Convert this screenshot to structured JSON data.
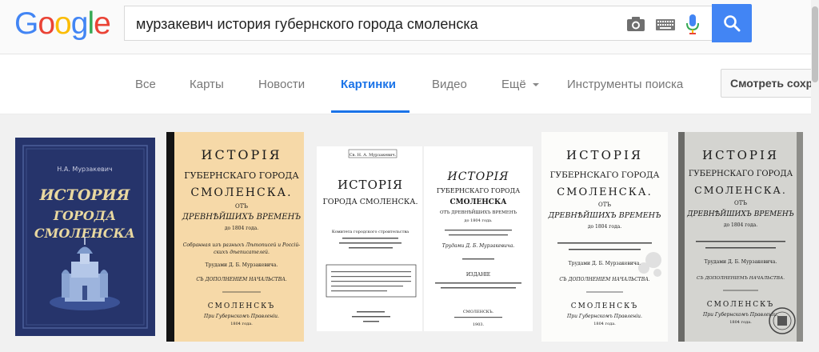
{
  "logo": {
    "text": "Google",
    "letters": [
      "G",
      "o",
      "o",
      "g",
      "l",
      "e"
    ],
    "colors": [
      "#4285f4",
      "#ea4335",
      "#fbbc05",
      "#4285f4",
      "#34a853",
      "#ea4335"
    ]
  },
  "search": {
    "query": "мурзакевич история губернского города смоленска"
  },
  "tabs": [
    {
      "label": "Все"
    },
    {
      "label": "Карты"
    },
    {
      "label": "Новости"
    },
    {
      "label": "Картинки",
      "active": true
    },
    {
      "label": "Видео"
    },
    {
      "label": "Ещё"
    }
  ],
  "tools": {
    "label": "Инструменты поиска"
  },
  "saved": {
    "label": "Смотреть сохранённые"
  },
  "accent": "#1a73e8",
  "covers": {
    "c1": {
      "author": "Н.А. Мурзакевич",
      "l1": "ИСТОРИЯ",
      "l2": "ГОРОДА",
      "l3": "СМОЛЕНСКА"
    },
    "c2": {
      "l1": "ИСТОРІЯ",
      "l2": "ГУБЕРНСКАГО ГОРОДА",
      "l3": "СМОЛЕНСКА.",
      "l4": "ОТЪ",
      "l5": "ДРЕВНѢЙШИХЪ ВРЕМЕНЪ",
      "l6": "до 1804 года.",
      "l7": "Собранная изъ разныхъ Лѣтописей и Россій-",
      "l8": "скихъ дѣеписателей.",
      "l9": "Трудами Д. Б. Мурзакевича.",
      "l10": "СЪ ДОПОЛНЕНІЕМ НАЧАЛЬСТВА.",
      "l11": "СМОЛЕНСКЪ",
      "l12": "При Губернскомъ Правленіи.",
      "l13": "1804 года."
    },
    "c3": {
      "top": "Св. Н. А. Мурзакевич.",
      "l1": "ИСТОРІЯ",
      "l2": "ГОРОДА СМОЛЕНСКА.",
      "l3": "Комитета городского строительства"
    },
    "c4": {
      "l1": "ИСТОРІЯ",
      "l2": "ГУБЕРНСКАГО ГОРОДА",
      "l3": "СМОЛЕНСКА",
      "l4": "ОТЪ ДРЕВНѢЙШИХЪ ВРЕМЕНЪ",
      "l5": "до 1804 года.",
      "l6": "Трудами Д. Б. Мурзакевича.",
      "l7": "ИЗДАНІЕ",
      "l8": "СМОЛЕНСКЪ.",
      "l9": "1903."
    },
    "c5": {
      "l1": "ИСТОРІЯ",
      "l2": "ГУБЕРНСКАГО ГОРОДА",
      "l3": "СМОЛЕНСКА.",
      "l4": "ОТЪ",
      "l5": "ДРЕВНѢЙШИХЪ ВРЕМЕНЪ",
      "l6": "до 1804 года.",
      "l7": "Трудами Д. Б. Мурзакевича.",
      "l8": "СЪ ДОПОЛНЕНІЕМ НАЧАЛЬСТВА.",
      "l9": "СМОЛЕНСКЪ",
      "l10": "При Губернскомъ Правленіи.",
      "l11": "1804 года."
    },
    "c6": {
      "l1": "ИСТОРІЯ",
      "l2": "ГУБЕРНСКАГО ГОРОДА",
      "l3": "СМОЛЕНСКА.",
      "l4": "ОТЪ",
      "l5": "ДРЕВНѢЙШИХЪ ВРЕМЕНЪ",
      "l6": "до 1804 года.",
      "l7": "Трудами Д. Б. Мурзакевича.",
      "l8": "СЪ ДОПОЛНЕНІЕМЪ НАЧАЛЬСТВА.",
      "l9": "СМОЛЕНСКЪ",
      "l10": "При Губернскомъ Правленіи.",
      "l11": "1804 года."
    }
  }
}
